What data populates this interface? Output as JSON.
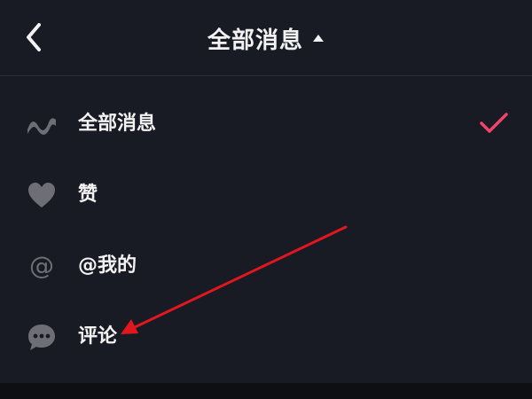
{
  "header": {
    "title": "全部消息",
    "back_icon": "chevron-left-icon",
    "caret_icon": "triangle-up-icon"
  },
  "menu": {
    "items": [
      {
        "label": "全部消息",
        "icon": "activity-wave-icon",
        "selected": true
      },
      {
        "label": "赞",
        "icon": "heart-icon",
        "selected": false
      },
      {
        "label": "@我的",
        "icon": "at-sign-icon",
        "selected": false
      },
      {
        "label": "评论",
        "icon": "comment-bubble-icon",
        "selected": false
      }
    ],
    "check_icon": "checkmark-icon"
  },
  "colors": {
    "background": "#181a24",
    "icon": "#6e6f76",
    "text": "#f2f2f2",
    "accent": "#f0436a",
    "annotation_arrow": "#e0171f"
  }
}
